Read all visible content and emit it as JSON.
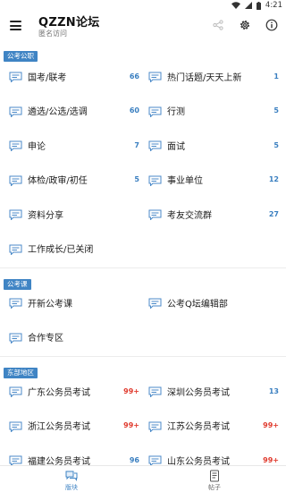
{
  "status": {
    "time": "4:21"
  },
  "header": {
    "title": "QZZN论坛",
    "subtitle": "匿名访问"
  },
  "sections": [
    {
      "tag": "公考公职",
      "items": [
        {
          "label": "国考/联考",
          "count": "66"
        },
        {
          "label": "热门话题/天天上新",
          "count": "1"
        },
        {
          "label": "遴选/公选/选调",
          "count": "60"
        },
        {
          "label": "行测",
          "count": "5"
        },
        {
          "label": "申论",
          "count": "7"
        },
        {
          "label": "面试",
          "count": "5"
        },
        {
          "label": "体检/政审/初任",
          "count": "5"
        },
        {
          "label": "事业单位",
          "count": "12"
        },
        {
          "label": "资料分享",
          "count": ""
        },
        {
          "label": "考友交流群",
          "count": "27"
        },
        {
          "label": "工作成长/已关闭",
          "count": ""
        }
      ]
    },
    {
      "tag": "公考课",
      "items": [
        {
          "label": "开新公考课",
          "count": ""
        },
        {
          "label": "公考Q坛编辑部",
          "count": ""
        },
        {
          "label": "合作专区",
          "count": ""
        }
      ]
    },
    {
      "tag": "东部地区",
      "items": [
        {
          "label": "广东公务员考试",
          "count": "99+"
        },
        {
          "label": "深圳公务员考试",
          "count": "13"
        },
        {
          "label": "浙江公务员考试",
          "count": "99+"
        },
        {
          "label": "江苏公务员考试",
          "count": "99+"
        },
        {
          "label": "福建公务员考试",
          "count": "96"
        },
        {
          "label": "山东公务员考试",
          "count": "99+"
        }
      ]
    }
  ],
  "bottom_nav": [
    {
      "label": "版块",
      "icon": "forum-icon",
      "active": true
    },
    {
      "label": "帖子",
      "icon": "posts-icon",
      "active": false
    }
  ],
  "colors": {
    "accent": "#3f84c4",
    "hot": "#e03b2e",
    "count": "#3a7fc0"
  }
}
